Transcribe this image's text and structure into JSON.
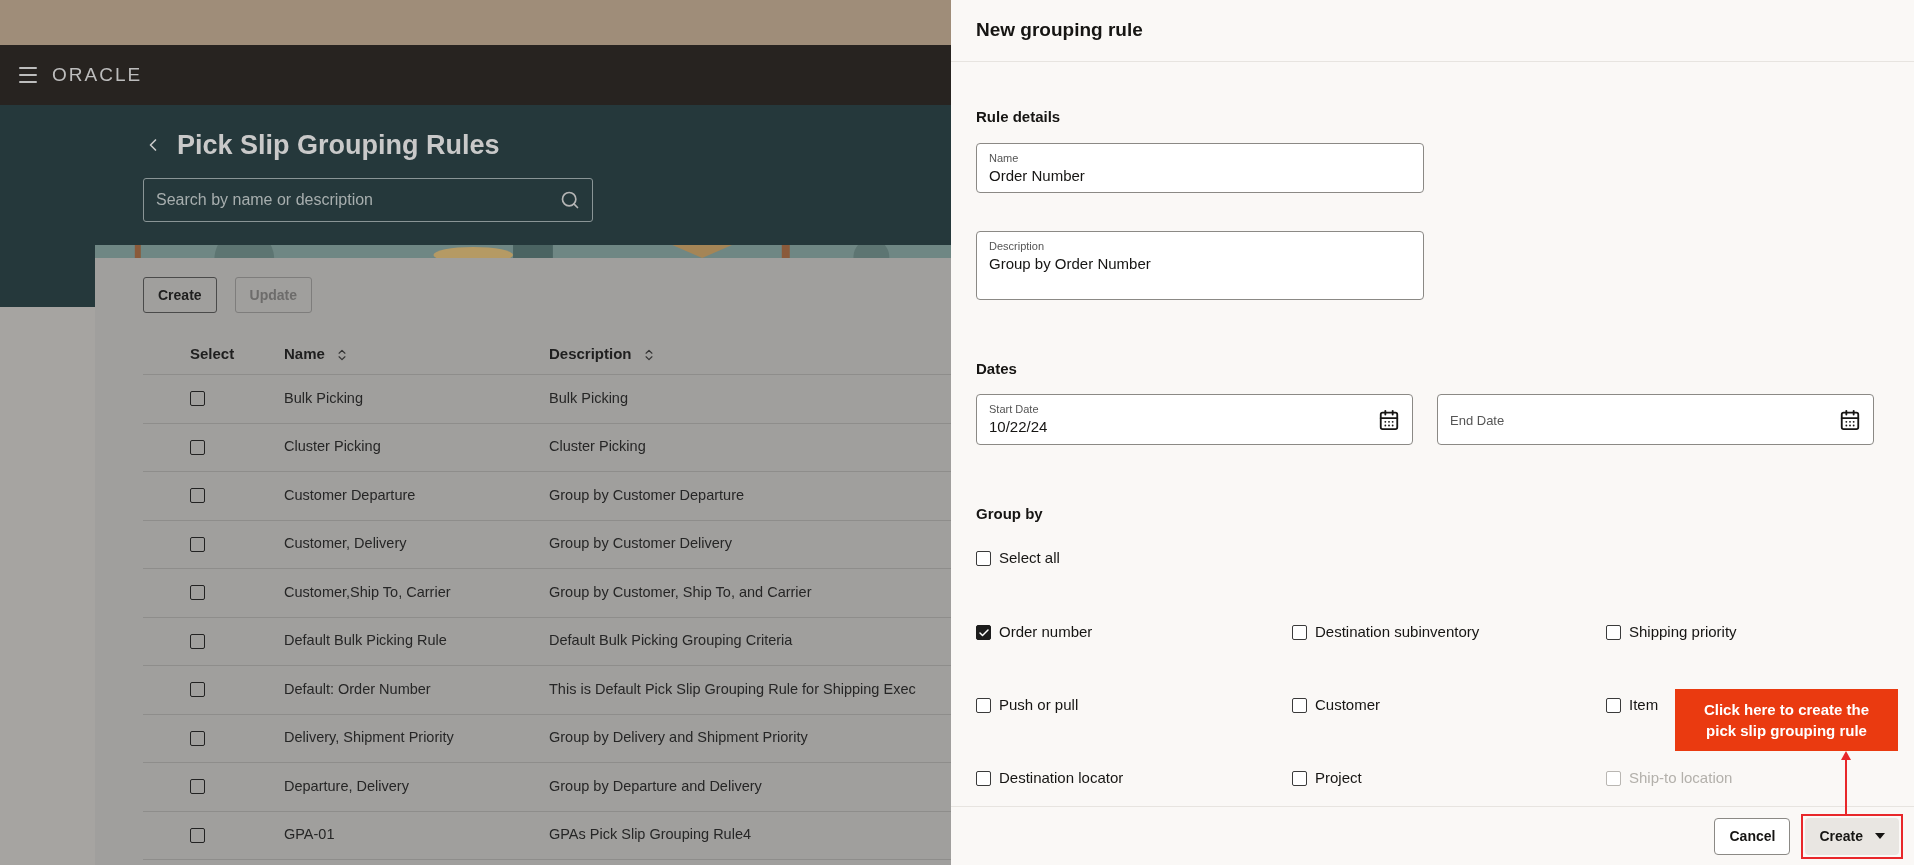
{
  "top_bar": {
    "logo": "ORACLE"
  },
  "page": {
    "title": "Pick Slip Grouping Rules",
    "search": {
      "placeholder": "Search by name or description"
    },
    "toolbar": [
      {
        "label": "Create",
        "disabled": false
      },
      {
        "label": "Update",
        "disabled": true
      }
    ],
    "table": {
      "columns": [
        {
          "label": "Select",
          "sortable": false
        },
        {
          "label": "Name",
          "sortable": true
        },
        {
          "label": "Description",
          "sortable": true
        }
      ],
      "rows": [
        {
          "selected": false,
          "name": "Bulk Picking",
          "description": "Bulk Picking"
        },
        {
          "selected": false,
          "name": "Cluster Picking",
          "description": "Cluster Picking"
        },
        {
          "selected": false,
          "name": "Customer Departure",
          "description": "Group by Customer Departure"
        },
        {
          "selected": false,
          "name": "Customer, Delivery",
          "description": "Group by Customer Delivery"
        },
        {
          "selected": false,
          "name": "Customer,Ship To, Carrier",
          "description": "Group by Customer, Ship To, and Carrier"
        },
        {
          "selected": false,
          "name": "Default Bulk Picking Rule",
          "description": "Default Bulk Picking Grouping Criteria"
        },
        {
          "selected": false,
          "name": "Default: Order Number",
          "description": "This is Default Pick Slip Grouping Rule for Shipping Exec"
        },
        {
          "selected": false,
          "name": "Delivery, Shipment Priority",
          "description": "Group by Delivery and Shipment Priority"
        },
        {
          "selected": false,
          "name": "Departure, Delivery",
          "description": "Group by Departure and Delivery"
        },
        {
          "selected": false,
          "name": "GPA-01",
          "description": "GPAs Pick Slip Grouping Rule4"
        }
      ]
    }
  },
  "drawer": {
    "title": "New grouping rule",
    "rule_details": {
      "heading": "Rule details",
      "name": {
        "label": "Name",
        "value": "Order Number"
      },
      "description": {
        "label": "Description",
        "value": "Group by Order Number"
      }
    },
    "dates": {
      "heading": "Dates",
      "start_date": {
        "label": "Start Date",
        "value": "10/22/24"
      },
      "end_date": {
        "placeholder": "End Date"
      }
    },
    "group_by": {
      "heading": "Group by",
      "select_all": {
        "label": "Select all",
        "checked": false
      },
      "options": [
        {
          "label": "Order number",
          "checked": true,
          "disabled": false
        },
        {
          "label": "Destination subinventory",
          "checked": false,
          "disabled": false
        },
        {
          "label": "Shipping priority",
          "checked": false,
          "disabled": false
        },
        {
          "label": "Push or pull",
          "checked": false,
          "disabled": false
        },
        {
          "label": "Customer",
          "checked": false,
          "disabled": false
        },
        {
          "label": "Item",
          "checked": false,
          "disabled": false
        },
        {
          "label": "Destination locator",
          "checked": false,
          "disabled": false
        },
        {
          "label": "Project",
          "checked": false,
          "disabled": false
        },
        {
          "label": "Ship-to location",
          "checked": false,
          "disabled": true
        }
      ]
    },
    "footer": [
      {
        "label": "Cancel",
        "kind": "secondary"
      },
      {
        "label": "Create",
        "kind": "menu",
        "highlighted": true
      }
    ],
    "callout": {
      "text": "Click here to create the pick slip grouping rule"
    }
  }
}
